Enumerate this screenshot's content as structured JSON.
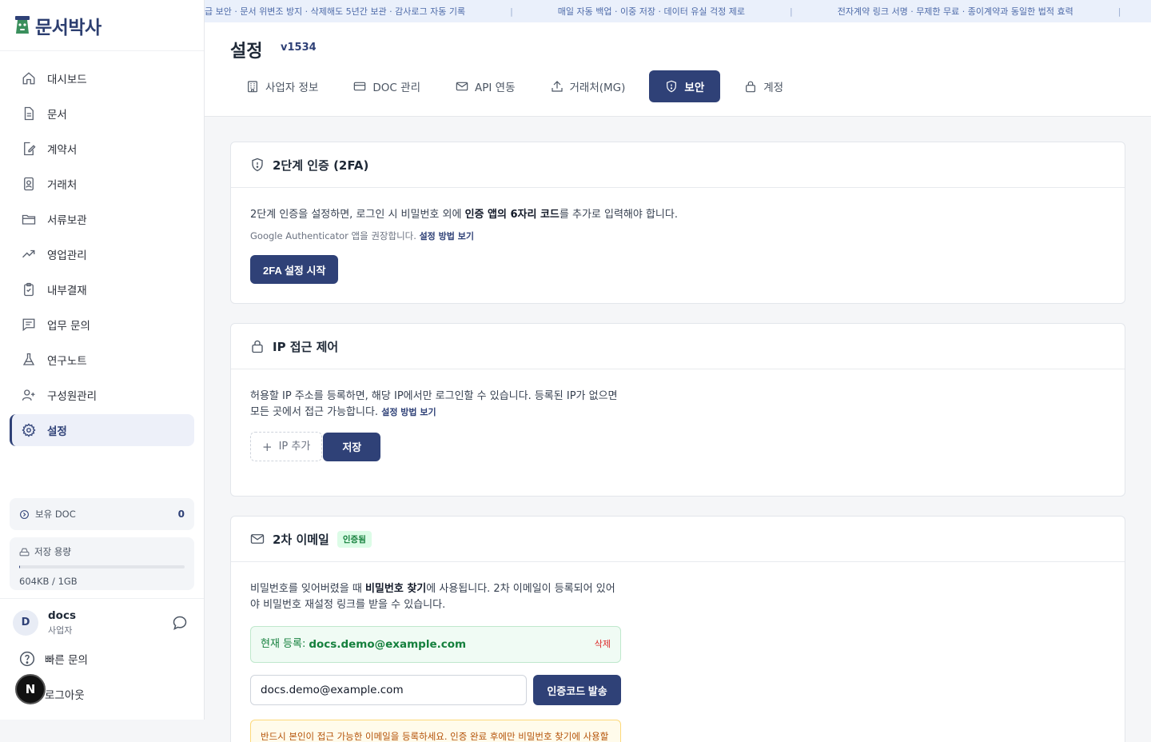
{
  "app": {
    "logo_text": "문서박사"
  },
  "ticker": {
    "items": [
      "급 보안 · 문서 위변조 방지 · 삭제해도 5년간 보관 · 감사로그 자동 기록",
      "매일 자동 백업 · 이중 저장 · 데이터 유실 걱정 제로",
      "전자계약 링크 서명 · 무제한 무료 · 종이계약과 동일한 법적 효력"
    ]
  },
  "sidebar": {
    "items": [
      {
        "label": "대시보드",
        "icon": "home-icon"
      },
      {
        "label": "문서",
        "icon": "document-icon"
      },
      {
        "label": "계약서",
        "icon": "contract-edit-icon"
      },
      {
        "label": "거래처",
        "icon": "contact-card-icon"
      },
      {
        "label": "서류보관",
        "icon": "folder-icon"
      },
      {
        "label": "영업관리",
        "icon": "trend-icon"
      },
      {
        "label": "내부결재",
        "icon": "clipboard-check-icon"
      },
      {
        "label": "업무 문의",
        "icon": "message-square-icon"
      },
      {
        "label": "연구노트",
        "icon": "flask-icon"
      },
      {
        "label": "구성원관리",
        "icon": "user-plus-icon"
      },
      {
        "label": "설정",
        "icon": "gear-icon",
        "active": true
      }
    ],
    "doc_label": "보유 DOC",
    "doc_value": "0",
    "storage_label": "저장 용량",
    "storage_value": "604KB / 1GB",
    "storage_fraction": 0.0006,
    "user": {
      "initial": "D",
      "name": "docs",
      "role": "사업자"
    },
    "quick_inquiry": "빠른 문의",
    "logout": "로그아웃",
    "n_badge": "N"
  },
  "header": {
    "title": "설정",
    "version": "v1534",
    "tabs": [
      {
        "label": "사업자 정보",
        "icon": "building-icon"
      },
      {
        "label": "DOC 관리",
        "icon": "card-icon"
      },
      {
        "label": "API 연동",
        "icon": "mail-icon"
      },
      {
        "label": "거래처(MG)",
        "icon": "upload-icon"
      },
      {
        "label": "보안",
        "icon": "shield-icon",
        "active": true
      },
      {
        "label": "계정",
        "icon": "lock-icon"
      }
    ]
  },
  "twofa": {
    "title": "2단계 인증 (2FA)",
    "desc_pre": "2단계 인증을 설정하면, 로그인 시 비밀번호 외에 ",
    "desc_bold": "인증 앱의 6자리 코드",
    "desc_post": "를 추가로 입력해야 합니다.",
    "note": "Google Authenticator 앱을 권장합니다.",
    "note_link": "설정 방법 보기",
    "button": "2FA 설정 시작"
  },
  "ip": {
    "title": "IP 접근 제어",
    "desc": "허용할 IP 주소를 등록하면, 해당 IP에서만 로그인할 수 있습니다. 등록된 IP가 없으면 모든 곳에서 접근 가능합니다.",
    "link": "설정 방법 보기",
    "add_button": "IP 추가",
    "save_button": "저장"
  },
  "email2": {
    "title": "2차 이메일",
    "badge": "인증됨",
    "desc_pre": "비밀번호를 잊어버렸을 때 ",
    "desc_bold": "비밀번호 찾기",
    "desc_post": "에 사용됩니다. 2차 이메일이 등록되어 있어야 비밀번호 재설정 링크를 받을 수 있습니다.",
    "registered_label": "현재 등록:",
    "registered_email": "docs.demo@example.com",
    "delete": "삭제",
    "input_value": "docs.demo@example.com",
    "send_button": "인증코드 발송",
    "warning": "반드시 본인이 접근 가능한 이메일을 등록하세요. 인증 완료 후에만 비밀번호 찾기에 사용할"
  },
  "colors": {
    "primary": "#2f4177",
    "success": "#15803d",
    "danger": "#dc2626"
  }
}
